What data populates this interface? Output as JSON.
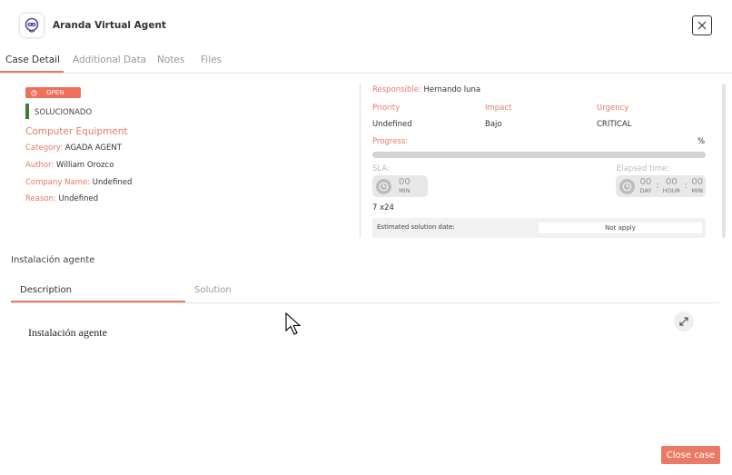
{
  "app": {
    "title": "Aranda Virtual Agent",
    "logo_icon": "headset-bot-icon"
  },
  "tabs": [
    {
      "label": "Case Detail",
      "active": true
    },
    {
      "label": "Additional Data",
      "active": false
    },
    {
      "label": "Notes",
      "active": false
    },
    {
      "label": "Files",
      "active": false
    }
  ],
  "case": {
    "status": "OPEN",
    "state": "SOLUCIONADO",
    "service": "Computer Equipment",
    "fields": {
      "category_label": "Category:",
      "category_value": "AGADA AGENT",
      "author_label": "Author:",
      "author_value": "William Orozco",
      "company_label": "Company Name:",
      "company_value": "Undefined",
      "reason_label": "Reason:",
      "reason_value": "Undefined"
    },
    "responsible_label": "Responsible:",
    "responsible_value": "Hernando luna",
    "priority_label": "Priority",
    "priority_value": "Undefined",
    "impact_label": "Impact",
    "impact_value": "Bajo",
    "urgency_label": "Urgency",
    "urgency_value": "CRITICAL",
    "progress_label": "Progress:",
    "progress_unit": "%",
    "progress_value": 0,
    "sla_label": "SLA:",
    "sla_value": "00",
    "sla_unit": "MIN",
    "schedule": "7 x24",
    "elapsed_label": "Elapsed time:",
    "elapsed": {
      "day": "00",
      "hour": "00",
      "min": "00",
      "day_unit": "DAY",
      "hour_unit": "HOUR",
      "min_unit": "MIN",
      "sep": ":"
    },
    "estimated_label": "Estimated solution date:",
    "estimated_value": "Not apply",
    "subject": "Instalación agente"
  },
  "subtabs": [
    {
      "label": "Description",
      "active": true
    },
    {
      "label": "Solution",
      "active": false
    }
  ],
  "description": "Instalación agente",
  "actions": {
    "close_case": "Close case"
  },
  "colors": {
    "accent": "#e97a66",
    "status_open": "#ef6f5c",
    "state_solved": "#3e7d32"
  }
}
